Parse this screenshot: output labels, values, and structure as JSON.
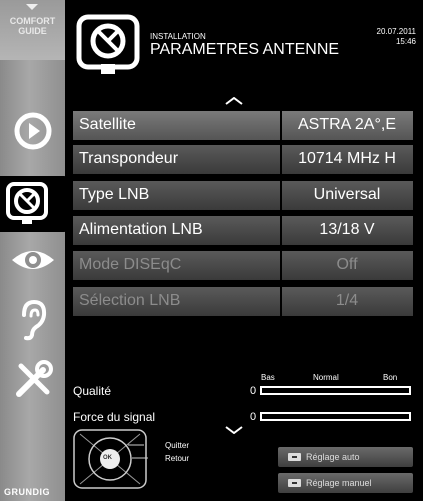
{
  "sidebar": {
    "comfort_line1": "COMFORT",
    "comfort_line2": "GUIDE",
    "brand": "GRUNDIG",
    "icons": [
      "play-icon",
      "satellite-dish-icon",
      "eye-icon",
      "ear-icon",
      "tools-icon"
    ]
  },
  "header": {
    "section": "INSTALLATION",
    "title": "PARAMETRES ANTENNE",
    "date": "20.07.2011",
    "time": "15:46"
  },
  "settings": [
    {
      "label": "Satellite",
      "value": "ASTRA 2A°,E",
      "state": "selected"
    },
    {
      "label": "Transpondeur",
      "value": "10714 MHz H",
      "state": "enabled"
    },
    {
      "label": "Type LNB",
      "value": "Universal",
      "state": "enabled"
    },
    {
      "label": "Alimentation LNB",
      "value": "13/18 V",
      "state": "enabled"
    },
    {
      "label": "Mode DISEqC",
      "value": "Off",
      "state": "disabled"
    },
    {
      "label": "Sélection LNB",
      "value": "1/4",
      "state": "disabled"
    }
  ],
  "signal": {
    "scale_low": "Bas",
    "scale_mid": "Normal",
    "scale_high": "Bon",
    "quality_label": "Qualité",
    "quality_value": "0",
    "strength_label": "Force du signal",
    "strength_value": "0"
  },
  "remote": {
    "ok": "OK",
    "quit": "Quitter",
    "back": "Retour"
  },
  "buttons": {
    "auto_scan": "Réglage auto",
    "manual_scan": "Réglage manuel"
  },
  "colors": {
    "background": "#000000",
    "row": "#4a4a4a",
    "sidebar": "#9a9a9a"
  }
}
